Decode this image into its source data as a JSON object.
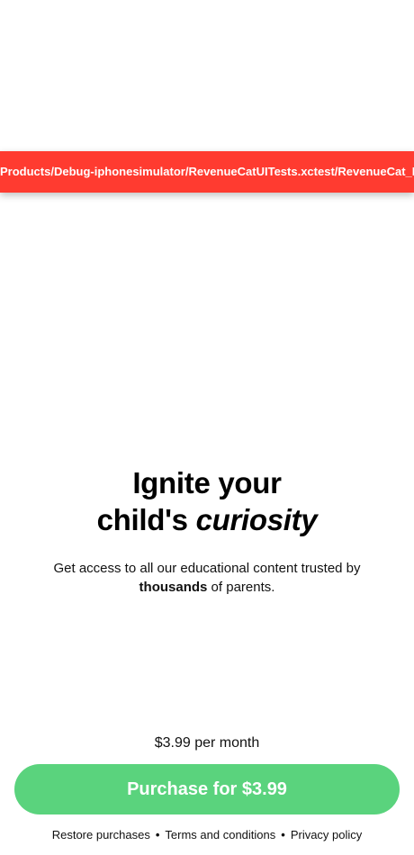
{
  "error_banner": {
    "text": "Products/Debug-iphonesimulator/RevenueCatUITests.xctest/RevenueCat_Reve",
    "color": "#ff3b30"
  },
  "paywall": {
    "headline_line1": "Ignite your",
    "headline_line2_prefix": "child's ",
    "headline_line2_emphasis": "curiosity",
    "subtitle_before": "Get access to all our educational content trusted by ",
    "subtitle_bold": "thousands",
    "subtitle_after": " of parents.",
    "price_label": "$3.99 per month",
    "purchase_button_label": "Purchase for $3.99",
    "accent_color": "#5ad37d"
  },
  "footer": {
    "links": [
      "Restore purchases",
      "Terms and conditions",
      "Privacy policy"
    ],
    "separator": "•"
  }
}
